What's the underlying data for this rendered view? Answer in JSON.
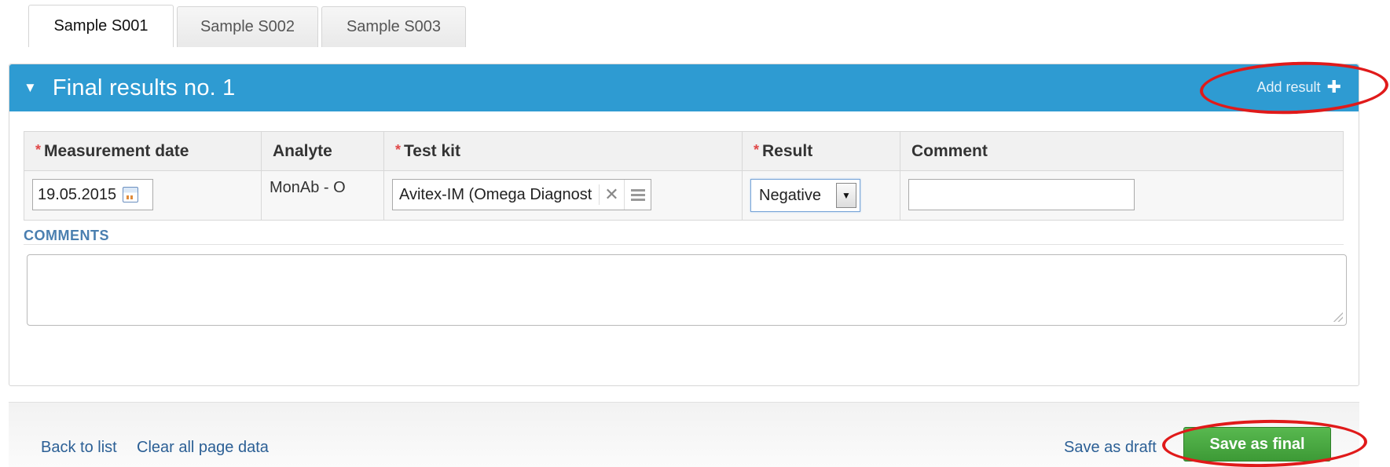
{
  "tabs": [
    {
      "label": "Sample S001",
      "active": true
    },
    {
      "label": "Sample S002",
      "active": false
    },
    {
      "label": "Sample S003",
      "active": false
    }
  ],
  "panel": {
    "caret": "▼",
    "title": "Final results no. 1",
    "add_result_label": "Add result",
    "add_result_icon": "plus-icon",
    "header_color": "#2e9bd2"
  },
  "table": {
    "headers": {
      "measurement_date": "Measurement date",
      "analyte": "Analyte",
      "test_kit": "Test kit",
      "result": "Result",
      "comment": "Comment"
    },
    "required_marker": "*",
    "row": {
      "measurement_date": "19.05.2015",
      "analyte": "MonAb - O",
      "test_kit": "Avitex-IM (Omega Diagnost",
      "result": "Negative",
      "comment": ""
    }
  },
  "comments": {
    "label": "COMMENTS",
    "value": ""
  },
  "footer": {
    "back_to_list": "Back to list",
    "clear_all_page_data": "Clear all page data",
    "save_as_draft": "Save as draft",
    "save_as_final": "Save as final",
    "save_final_color": "#4aa943"
  },
  "annotation_color": "#e01a1a"
}
